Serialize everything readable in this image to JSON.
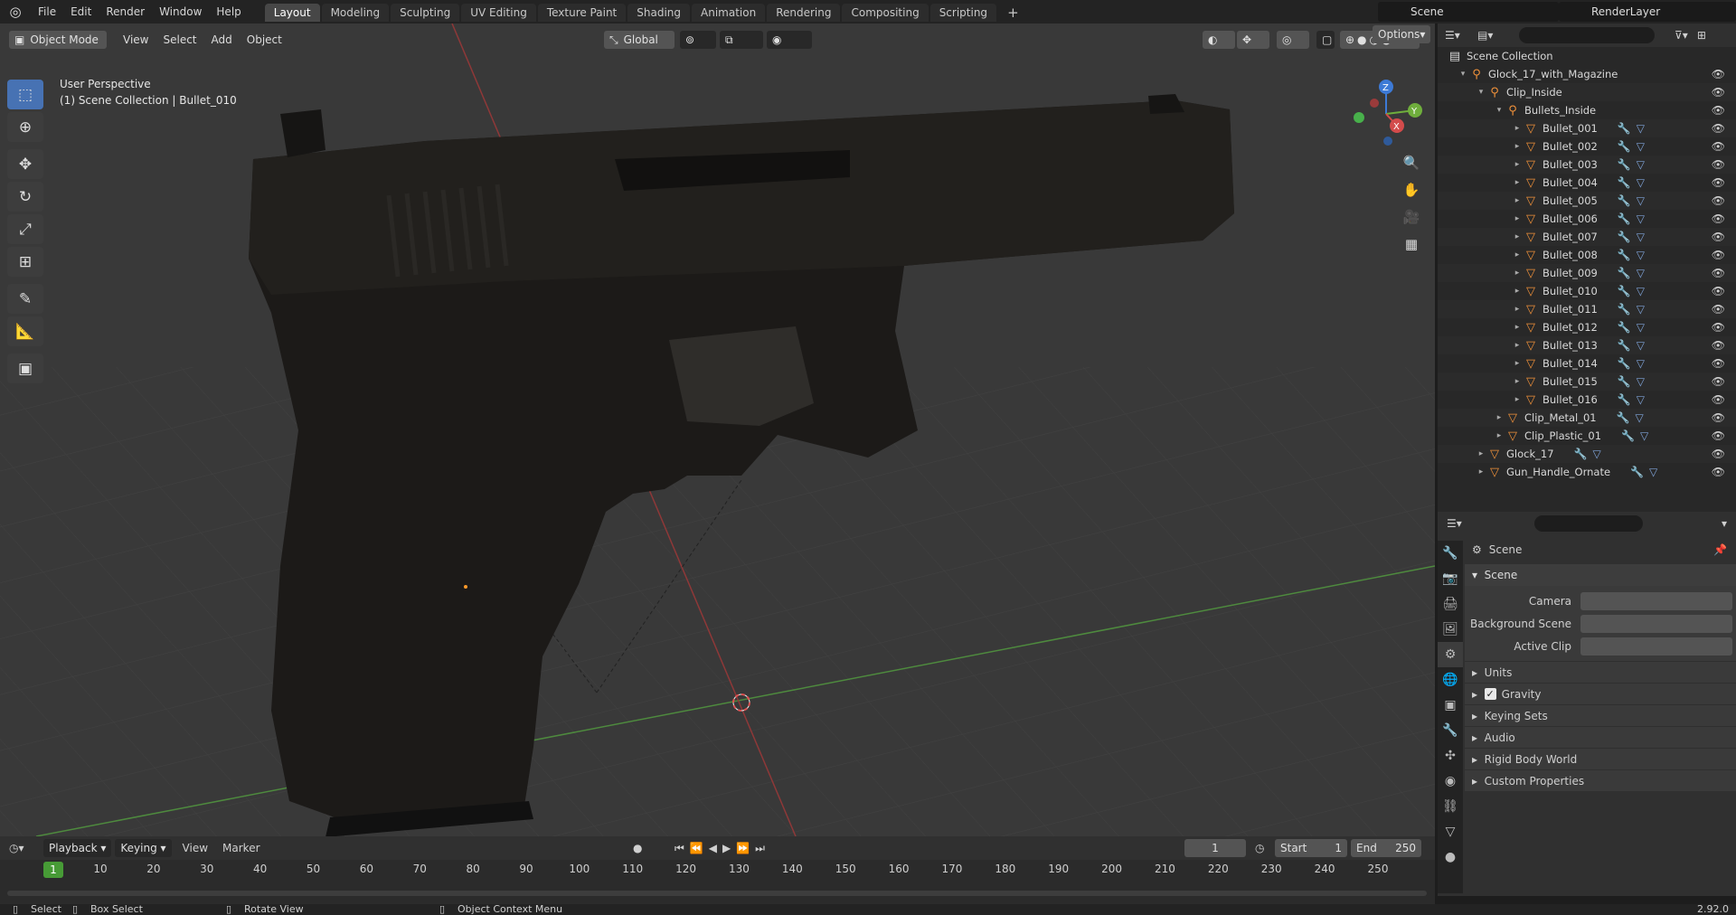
{
  "topbar": {
    "menu": [
      "File",
      "Edit",
      "Render",
      "Window",
      "Help"
    ],
    "workspaces": [
      "Layout",
      "Modeling",
      "Sculpting",
      "UV Editing",
      "Texture Paint",
      "Shading",
      "Animation",
      "Rendering",
      "Compositing",
      "Scripting"
    ],
    "active_workspace": "Layout",
    "scene": "Scene",
    "render_layer": "RenderLayer"
  },
  "viewport": {
    "mode": "Object Mode",
    "menu": [
      "View",
      "Select",
      "Add",
      "Object"
    ],
    "transform": "Global",
    "options": "Options",
    "perspective": "User Perspective",
    "context": "(1) Scene Collection | Bullet_010",
    "gizmo": {
      "z": "Z",
      "y": "Y",
      "x": "X"
    }
  },
  "outliner": {
    "root": "Scene Collection",
    "items": [
      {
        "label": "Glock_17_with_Magazine",
        "depth": 0,
        "type": "collection"
      },
      {
        "label": "Clip_Inside",
        "depth": 1,
        "type": "collection"
      },
      {
        "label": "Bullets_Inside",
        "depth": 2,
        "type": "collection"
      },
      {
        "label": "Bullet_001",
        "depth": 3,
        "type": "mesh"
      },
      {
        "label": "Bullet_002",
        "depth": 3,
        "type": "mesh"
      },
      {
        "label": "Bullet_003",
        "depth": 3,
        "type": "mesh"
      },
      {
        "label": "Bullet_004",
        "depth": 3,
        "type": "mesh"
      },
      {
        "label": "Bullet_005",
        "depth": 3,
        "type": "mesh"
      },
      {
        "label": "Bullet_006",
        "depth": 3,
        "type": "mesh"
      },
      {
        "label": "Bullet_007",
        "depth": 3,
        "type": "mesh"
      },
      {
        "label": "Bullet_008",
        "depth": 3,
        "type": "mesh"
      },
      {
        "label": "Bullet_009",
        "depth": 3,
        "type": "mesh"
      },
      {
        "label": "Bullet_010",
        "depth": 3,
        "type": "mesh"
      },
      {
        "label": "Bullet_011",
        "depth": 3,
        "type": "mesh"
      },
      {
        "label": "Bullet_012",
        "depth": 3,
        "type": "mesh"
      },
      {
        "label": "Bullet_013",
        "depth": 3,
        "type": "mesh"
      },
      {
        "label": "Bullet_014",
        "depth": 3,
        "type": "mesh"
      },
      {
        "label": "Bullet_015",
        "depth": 3,
        "type": "mesh"
      },
      {
        "label": "Bullet_016",
        "depth": 3,
        "type": "mesh"
      },
      {
        "label": "Clip_Metal_01",
        "depth": 2,
        "type": "mesh"
      },
      {
        "label": "Clip_Plastic_01",
        "depth": 2,
        "type": "mesh"
      },
      {
        "label": "Glock_17",
        "depth": 1,
        "type": "mesh"
      },
      {
        "label": "Gun_Handle_Ornate",
        "depth": 1,
        "type": "mesh"
      }
    ]
  },
  "properties": {
    "breadcrumb": "Scene",
    "panel": "Scene",
    "fields": [
      {
        "label": "Camera"
      },
      {
        "label": "Background Scene"
      },
      {
        "label": "Active Clip"
      }
    ],
    "subpanels": [
      "Units",
      "Gravity",
      "Keying Sets",
      "Audio",
      "Rigid Body World",
      "Custom Properties"
    ],
    "gravity_checked": true
  },
  "timeline": {
    "menu": [
      "Playback",
      "Keying",
      "View",
      "Marker"
    ],
    "current_frame": "1",
    "start_label": "Start",
    "start": "1",
    "end_label": "End",
    "end": "250",
    "ruler": [
      "1",
      "10",
      "20",
      "30",
      "40",
      "50",
      "60",
      "70",
      "80",
      "90",
      "100",
      "110",
      "120",
      "130",
      "140",
      "150",
      "160",
      "170",
      "180",
      "190",
      "200",
      "210",
      "220",
      "230",
      "240",
      "250"
    ]
  },
  "statusbar": {
    "select": "Select",
    "box_select": "Box Select",
    "rotate_view": "Rotate View",
    "context_menu": "Object Context Menu",
    "version": "2.92.0"
  },
  "colors": {
    "accent": "#4772b3",
    "orange": "#f0913a",
    "frame": "#479b36"
  }
}
